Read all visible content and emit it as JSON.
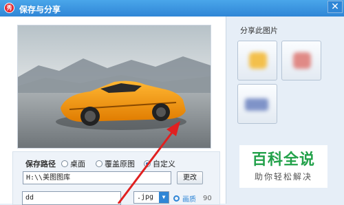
{
  "window": {
    "title": "保存与分享",
    "close_icon": "✕",
    "app_icon_text": "秀"
  },
  "save": {
    "path_label": "保存路径",
    "options": [
      {
        "label": "桌面",
        "selected": false
      },
      {
        "label": "覆盖原图",
        "selected": false
      },
      {
        "label": "自定义",
        "selected": true
      }
    ],
    "path_value": "H:\\\\美图图库",
    "change_button": "更改",
    "filename_value": "dd",
    "format_value": ".jpg",
    "quality_label": "画质",
    "quality_value": "90"
  },
  "share": {
    "title": "分享此图片",
    "buttons": [
      "share-weibo",
      "share-qzone",
      "share-mail"
    ]
  },
  "watermark": {
    "main": "百科全说",
    "sub": "助你轻松解决",
    "color": "#22a14a"
  },
  "annotation_arrow_color": "#e02020"
}
